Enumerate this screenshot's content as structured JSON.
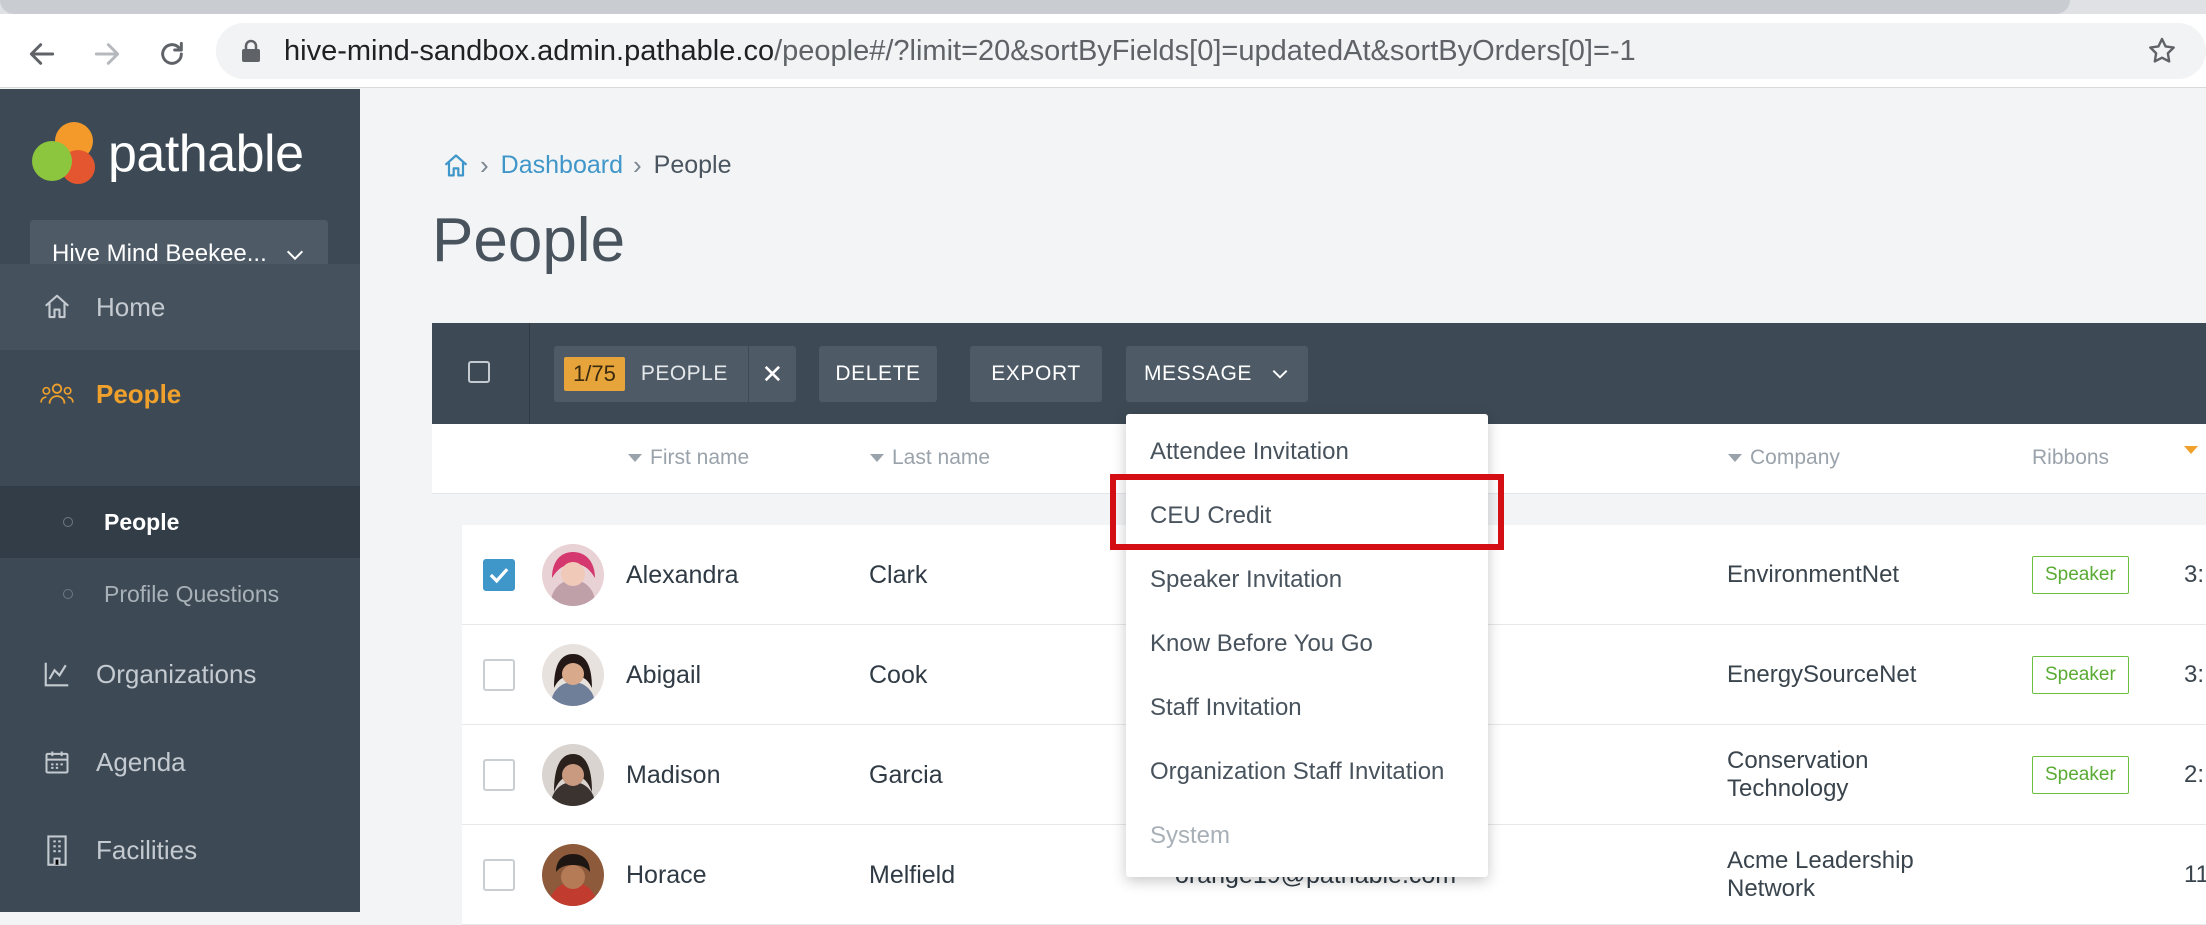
{
  "browser": {
    "url_host": "hive-mind-sandbox.admin.pathable.co",
    "url_path": "/people#/?limit=20&sortByFields[0]=updatedAt&sortByOrders[0]=-1",
    "icons": [
      "back-arrow-icon",
      "forward-arrow-icon",
      "reload-icon",
      "lock-icon",
      "bookmark-star-icon"
    ]
  },
  "sidebar": {
    "brand": "pathable",
    "org_select": "Hive Mind Beekee...",
    "nav": [
      {
        "label": "Home",
        "icon": "home-icon"
      },
      {
        "label": "People",
        "icon": "people-icon",
        "active": true
      },
      {
        "label": "Organizations",
        "icon": "chart-icon"
      },
      {
        "label": "Agenda",
        "icon": "calendar-icon"
      },
      {
        "label": "Facilities",
        "icon": "building-icon"
      }
    ],
    "sub_nav": [
      {
        "label": "People",
        "current": true
      },
      {
        "label": "Profile Questions"
      }
    ]
  },
  "breadcrumb": {
    "dashboard": "Dashboard",
    "current": "People"
  },
  "page_title": "People",
  "actions": {
    "selection_count": "1/75",
    "selection_label": "PEOPLE",
    "clear": "✕",
    "delete": "DELETE",
    "export": "EXPORT",
    "message": "MESSAGE"
  },
  "columns": {
    "first_name": "First name",
    "last_name": "Last name",
    "company": "Company",
    "ribbons": "Ribbons"
  },
  "rows": [
    {
      "first": "Alexandra",
      "last": "Clark",
      "email": "",
      "company": "EnvironmentNet",
      "ribbon": "Speaker",
      "date": "3:",
      "checked": true
    },
    {
      "first": "Abigail",
      "last": "Cook",
      "email": "",
      "company": "EnergySourceNet",
      "ribbon": "Speaker",
      "date": "3:",
      "checked": false
    },
    {
      "first": "Madison",
      "last": "Garcia",
      "email": "",
      "company": "Conservation Technology",
      "ribbon": "Speaker",
      "date": "2:",
      "checked": false
    },
    {
      "first": "Horace",
      "last": "Melfield",
      "email": "orange19@pathable.com",
      "company": "Acme Leadership Network",
      "ribbon": "",
      "date": "11",
      "checked": false
    }
  ],
  "message_menu": [
    {
      "label": "Attendee Invitation"
    },
    {
      "label": "CEU Credit",
      "highlighted": true
    },
    {
      "label": "Speaker Invitation"
    },
    {
      "label": "Know Before You Go"
    },
    {
      "label": "Staff Invitation"
    },
    {
      "label": "Organization Staff Invitation"
    },
    {
      "label": "System",
      "disabled": true
    }
  ],
  "colors": {
    "sidebar_bg": "#3d4a55",
    "accent_orange": "#f0a12c",
    "link_blue": "#3f96c9",
    "speaker_green": "#5aab33",
    "highlight_red": "#d40f14"
  }
}
